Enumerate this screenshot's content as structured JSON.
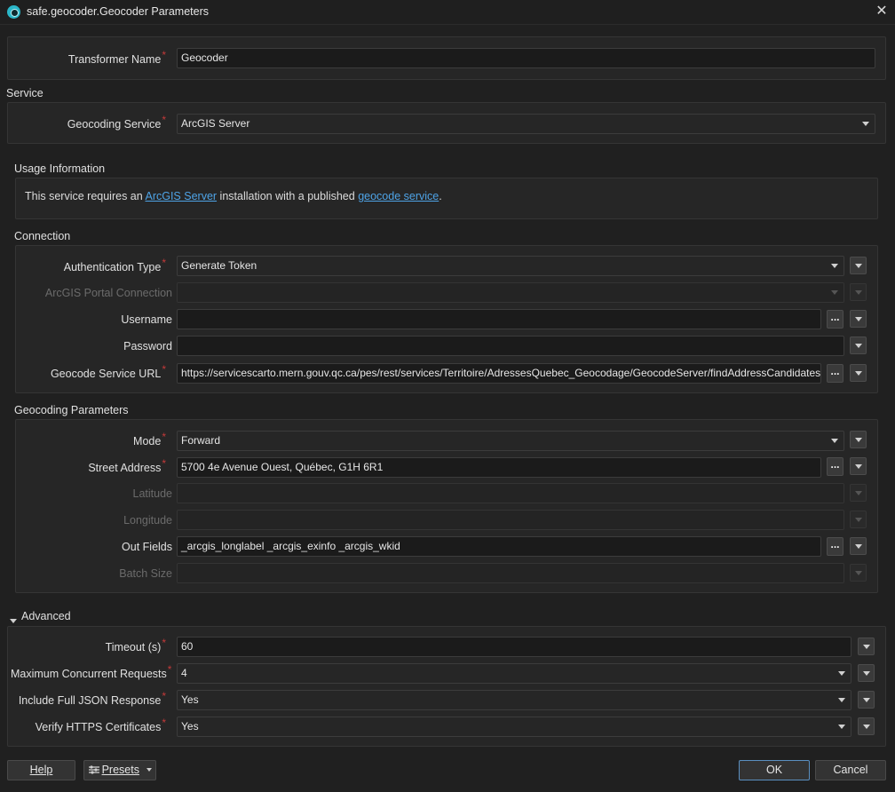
{
  "window": {
    "title": "safe.geocoder.Geocoder Parameters"
  },
  "transformer": {
    "label": "Transformer Name",
    "value": "Geocoder"
  },
  "service": {
    "section": "Service",
    "geocoding_service_label": "Geocoding Service",
    "geocoding_service_value": "ArcGIS Server"
  },
  "usage": {
    "section": "Usage Information",
    "text_before": "This service requires an ",
    "link1": "ArcGIS Server",
    "text_middle": " installation with a published ",
    "link2": "geocode service",
    "text_after": "."
  },
  "connection": {
    "section": "Connection",
    "auth_type_label": "Authentication Type",
    "auth_type_value": "Generate Token",
    "portal_label": "ArcGIS Portal Connection",
    "portal_value": "",
    "username_label": "Username",
    "username_value": "",
    "password_label": "Password",
    "password_value": "",
    "url_label": "Geocode Service URL",
    "url_value": "https://servicescarto.mern.gouv.qc.ca/pes/rest/services/Territoire/AdressesQuebec_Geocodage/GeocodeServer/findAddressCandidates"
  },
  "geocoding": {
    "section": "Geocoding Parameters",
    "mode_label": "Mode",
    "mode_value": "Forward",
    "street_label": "Street Address",
    "street_value": "5700 4e Avenue Ouest, Québec, G1H 6R1",
    "latitude_label": "Latitude",
    "longitude_label": "Longitude",
    "out_fields_label": "Out Fields",
    "out_fields_value": "_arcgis_longlabel _arcgis_exinfo _arcgis_wkid",
    "batch_size_label": "Batch Size"
  },
  "advanced": {
    "section": "Advanced",
    "timeout_label": "Timeout (s)",
    "timeout_value": "60",
    "max_requests_label": "Maximum Concurrent Requests",
    "max_requests_value": "4",
    "full_json_label": "Include Full JSON Response",
    "full_json_value": "Yes",
    "verify_https_label": "Verify HTTPS Certificates",
    "verify_https_value": "Yes"
  },
  "footer": {
    "help": "Help",
    "presets": "Presets",
    "ok": "OK",
    "cancel": "Cancel"
  },
  "common": {
    "ellipsis": "...",
    "required_mark": "*"
  }
}
